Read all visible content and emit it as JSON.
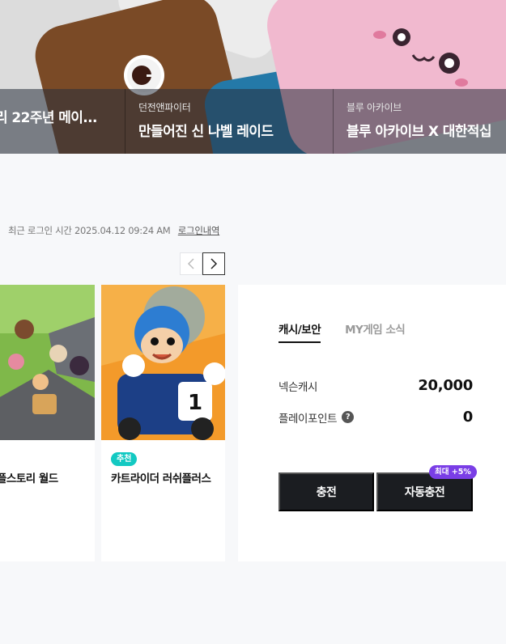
{
  "hero": {
    "cards": [
      {
        "category": "",
        "title": "리 22주년 메이..."
      },
      {
        "category": "던전앤파이터",
        "title": "만들어진 신 나벨 레이드"
      },
      {
        "category": "블루 아카이브",
        "title": "블루 아카이브 X 대한적십"
      }
    ]
  },
  "login": {
    "text": "최근 로그인 시간 2025.04.12 09:24 AM",
    "history_link": "로그인내역"
  },
  "carousel": {
    "prev_icon": "chevron-left-icon",
    "next_icon": "chevron-right-icon"
  },
  "games": [
    {
      "badge": "",
      "title": "플스토리 월드"
    },
    {
      "badge": "추천",
      "title": "카트라이더 러쉬플러스"
    }
  ],
  "cash": {
    "tabs": [
      "캐시/보안",
      "MY게임 소식"
    ],
    "rows": [
      {
        "label": "넥슨캐시",
        "value": "20,000"
      },
      {
        "label": "플레이포인트",
        "value": "0"
      }
    ],
    "charge_button": "충전",
    "auto_charge_button": "자동충전",
    "bonus_badge": "최대 +5%"
  },
  "colors": {
    "badge_teal": "#13c9c2",
    "bonus_purple": "#7a3ee6",
    "button_dark": "#1b1d21"
  }
}
